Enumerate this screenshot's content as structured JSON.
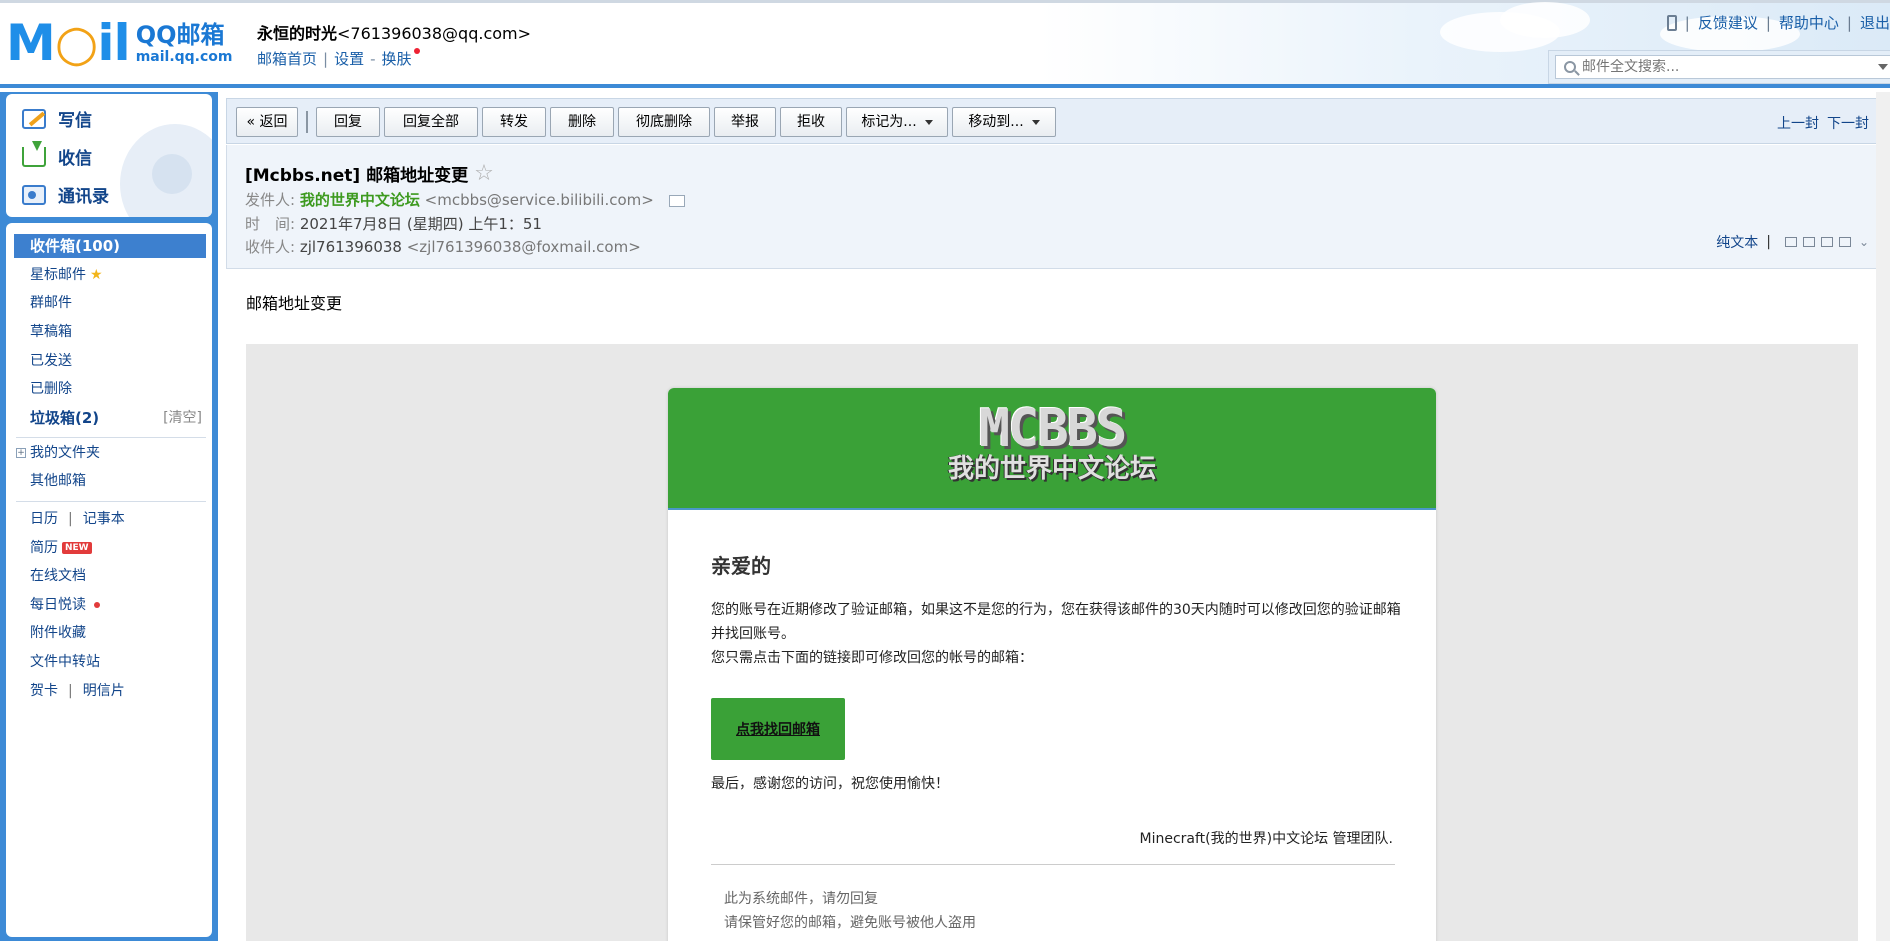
{
  "header": {
    "logo_mail": "MAIL",
    "logo_brand": "QQ邮箱",
    "logo_domain": "mail.qq.com",
    "account_name": "永恒的时光",
    "account_email": "<761396038@qq.com>",
    "link_home": "邮箱首页",
    "link_settings": "设置",
    "link_skin": "换肤",
    "top_feedback": "反馈建议",
    "top_help": "帮助中心",
    "top_logout": "退出",
    "search_placeholder": "邮件全文搜索..."
  },
  "quick": {
    "write": "写信",
    "inbox": "收信",
    "contacts": "通讯录"
  },
  "folders": {
    "inbox": "收件箱(100)",
    "starred": "星标邮件",
    "group": "群邮件",
    "drafts": "草稿箱",
    "sent": "已发送",
    "deleted": "已删除",
    "junk": "垃圾箱(2)",
    "junk_clear": "[清空]",
    "my_folders": "我的文件夹",
    "other_mail": "其他邮箱",
    "calendar": "日历",
    "notepad": "记事本",
    "resume": "简历",
    "resume_badge": "NEW",
    "online_docs": "在线文档",
    "daily_reading": "每日悦读",
    "attachments": "附件收藏",
    "file_transfer": "文件中转站",
    "greeting_card": "贺卡",
    "postcard": "明信片"
  },
  "toolbar": {
    "back": "« 返回",
    "reply": "回复",
    "reply_all": "回复全部",
    "forward": "转发",
    "delete": "删除",
    "delete_perm": "彻底删除",
    "report": "举报",
    "reject": "拒收",
    "mark_as": "标记为...",
    "move_to": "移动到...",
    "prev": "上一封",
    "next": "下一封"
  },
  "mail": {
    "subject": "[Mcbbs.net] 邮箱地址变更",
    "from_label": "发件人:",
    "from_name": "我的世界中文论坛",
    "from_addr": "<mcbbs@service.bilibili.com>",
    "time_label": "时　间:",
    "time_value": "2021年7月8日 (星期四) 上午1：51",
    "to_label": "收件人:",
    "to_name": "zjl761396038",
    "to_addr": "<zjl761396038@foxmail.com>",
    "plain_text": "纯文本",
    "body_title": "邮箱地址变更"
  },
  "card": {
    "logo_big": "MCBBS",
    "logo_small": "我的世界中文论坛",
    "greeting": "亲爱的",
    "para1": "您的账号在近期修改了验证邮箱，如果这不是您的行为，您在获得该邮件的30天内随时可以修改回您的验证邮箱并找回账号。",
    "para2": "您只需点击下面的链接即可修改回您的帐号的邮箱：",
    "button": "点我找回邮箱",
    "closing": "最后，感谢您的访问，祝您使用愉快！",
    "signature": "Minecraft(我的世界)中文论坛 管理团队.",
    "footer1": "此为系统邮件，请勿回复",
    "footer2": "请保管好您的邮箱，避免账号被他人盗用"
  },
  "colors": {
    "brand_blue": "#3d8ad6",
    "mc_green": "#3aa137",
    "sender_green": "#3d9a1f"
  }
}
